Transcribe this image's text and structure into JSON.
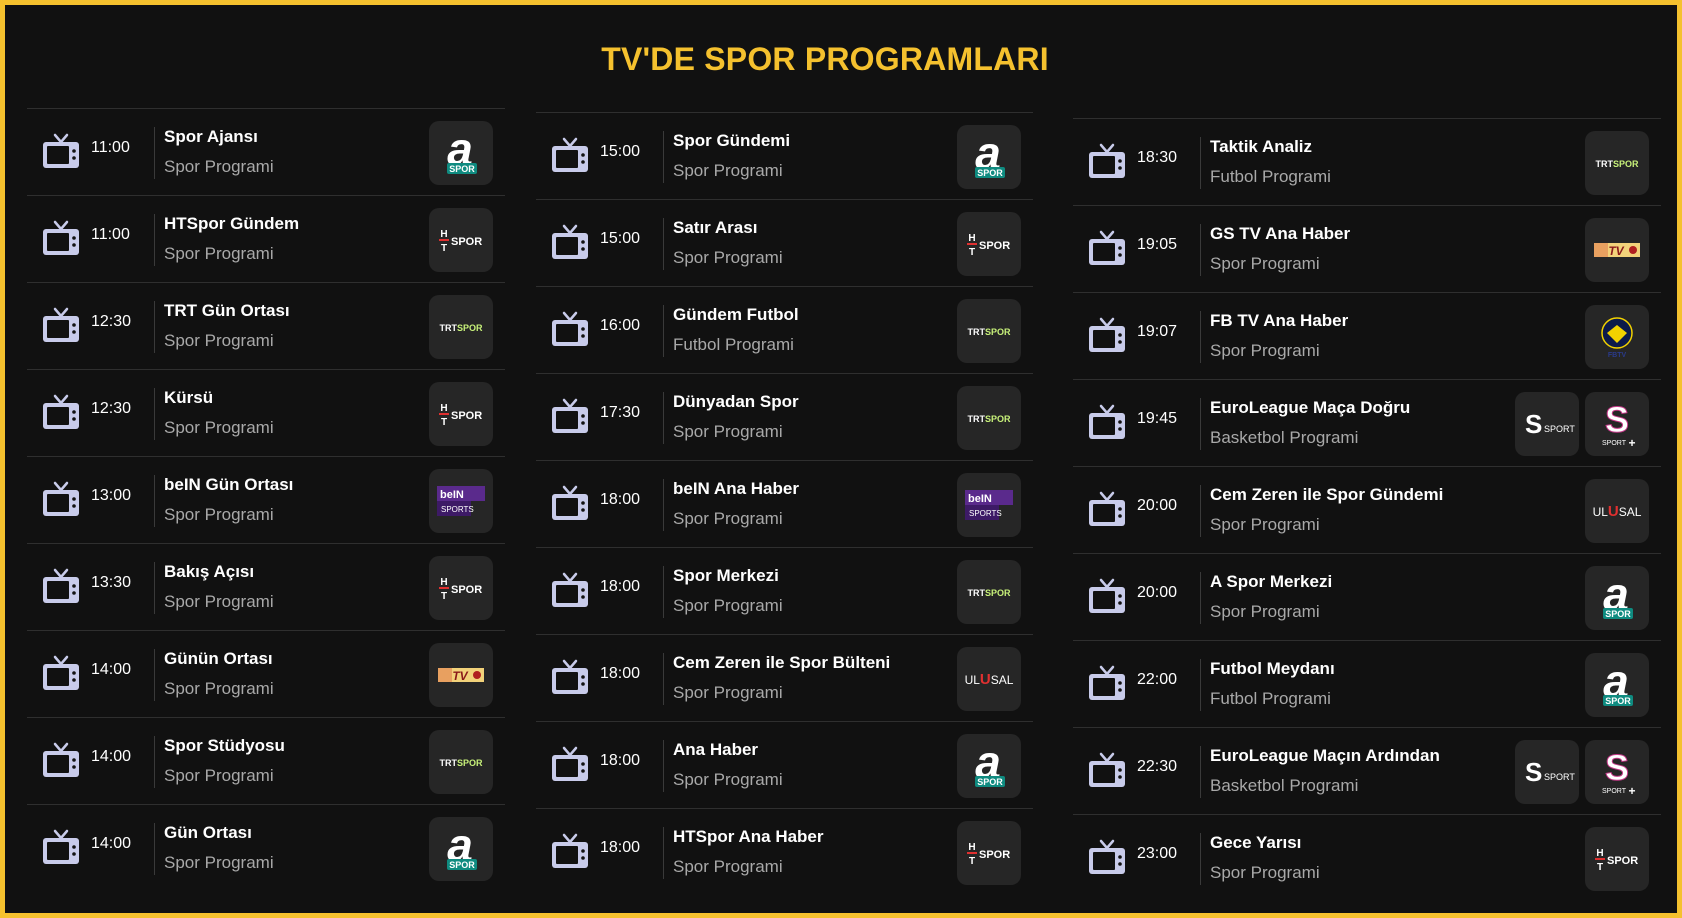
{
  "page": {
    "title": "TV'DE SPOR PROGRAMLARI"
  },
  "colors": {
    "accent": "#f5c12e",
    "background": "#111111",
    "card": "#262626",
    "muted": "#a9a9a9"
  },
  "columns": [
    {
      "rows": [
        {
          "time": "11:00",
          "name": "Spor Ajansı",
          "category": "Spor Programi",
          "channels": [
            "aspor"
          ]
        },
        {
          "time": "11:00",
          "name": "HTSpor Gündem",
          "category": "Spor Programi",
          "channels": [
            "htspor"
          ]
        },
        {
          "time": "12:30",
          "name": "TRT Gün Ortası",
          "category": "Spor Programi",
          "channels": [
            "trtspor"
          ]
        },
        {
          "time": "12:30",
          "name": "Kürsü",
          "category": "Spor Programi",
          "channels": [
            "htspor"
          ]
        },
        {
          "time": "13:00",
          "name": "beIN Gün Ortası",
          "category": "Spor Programi",
          "channels": [
            "bein"
          ]
        },
        {
          "time": "13:30",
          "name": "Bakış Açısı",
          "category": "Spor Programi",
          "channels": [
            "htspor"
          ]
        },
        {
          "time": "14:00",
          "name": "Günün Ortası",
          "category": "Spor Programi",
          "channels": [
            "gstv"
          ]
        },
        {
          "time": "14:00",
          "name": "Spor Stüdyosu",
          "category": "Spor Programi",
          "channels": [
            "trtspor"
          ]
        },
        {
          "time": "14:00",
          "name": "Gün Ortası",
          "category": "Spor Programi",
          "channels": [
            "aspor"
          ]
        }
      ]
    },
    {
      "rows": [
        {
          "time": "15:00",
          "name": "Spor Gündemi",
          "category": "Spor Programi",
          "channels": [
            "aspor"
          ]
        },
        {
          "time": "15:00",
          "name": "Satır Arası",
          "category": "Spor Programi",
          "channels": [
            "htspor"
          ]
        },
        {
          "time": "16:00",
          "name": "Gündem Futbol",
          "category": "Futbol Programi",
          "channels": [
            "trtspor"
          ]
        },
        {
          "time": "17:30",
          "name": "Dünyadan Spor",
          "category": "Spor Programi",
          "channels": [
            "trtspor"
          ]
        },
        {
          "time": "18:00",
          "name": "beIN Ana Haber",
          "category": "Spor Programi",
          "channels": [
            "bein"
          ]
        },
        {
          "time": "18:00",
          "name": "Spor Merkezi",
          "category": "Spor Programi",
          "channels": [
            "trtspor"
          ]
        },
        {
          "time": "18:00",
          "name": "Cem Zeren ile Spor Bülteni",
          "category": "Spor Programi",
          "channels": [
            "ulusal"
          ]
        },
        {
          "time": "18:00",
          "name": "Ana Haber",
          "category": "Spor Programi",
          "channels": [
            "aspor"
          ]
        },
        {
          "time": "18:00",
          "name": "HTSpor Ana Haber",
          "category": "Spor Programi",
          "channels": [
            "htspor"
          ]
        }
      ]
    },
    {
      "rows": [
        {
          "time": "18:30",
          "name": "Taktik Analiz",
          "category": "Futbol Programi",
          "channels": [
            "trtspor"
          ]
        },
        {
          "time": "19:05",
          "name": "GS TV Ana Haber",
          "category": "Spor Programi",
          "channels": [
            "gstv"
          ]
        },
        {
          "time": "19:07",
          "name": "FB TV Ana Haber",
          "category": "Spor Programi",
          "channels": [
            "fbtv"
          ]
        },
        {
          "time": "19:45",
          "name": "EuroLeague Maça Doğru",
          "category": "Basketbol Programi",
          "channels": [
            "ssport",
            "ssportplus"
          ]
        },
        {
          "time": "20:00",
          "name": "Cem Zeren ile Spor Gündemi",
          "category": "Spor Programi",
          "channels": [
            "ulusal"
          ]
        },
        {
          "time": "20:00",
          "name": "A Spor Merkezi",
          "category": "Spor Programi",
          "channels": [
            "aspor"
          ]
        },
        {
          "time": "22:00",
          "name": "Futbol Meydanı",
          "category": "Futbol Programi",
          "channels": [
            "aspor"
          ]
        },
        {
          "time": "22:30",
          "name": "EuroLeague Maçın Ardından",
          "category": "Basketbol Programi",
          "channels": [
            "ssport",
            "ssportplus"
          ]
        },
        {
          "time": "23:00",
          "name": "Gece Yarısı",
          "category": "Spor Programi",
          "channels": [
            "htspor"
          ]
        }
      ]
    }
  ],
  "logo_text": {
    "aspor": {
      "big": "a",
      "small": "SPOR"
    },
    "htspor": {
      "a": "H",
      "b": "T",
      "c": "SPOR"
    },
    "trtspor": {
      "a": "TRT",
      "b": "SPOR"
    },
    "bein": {
      "a": "be",
      "b": "IN",
      "c": "SPORTS"
    },
    "gstv": {
      "a": "TV"
    },
    "ulusal": {
      "a": "UL",
      "b": "U",
      "c": "SAL"
    },
    "fbtv": {
      "a": "FBTV"
    },
    "ssport": {
      "a": "S",
      "b": "SPORT"
    },
    "ssportplus": {
      "a": "S",
      "b": "SPORT",
      "c": "+"
    }
  }
}
